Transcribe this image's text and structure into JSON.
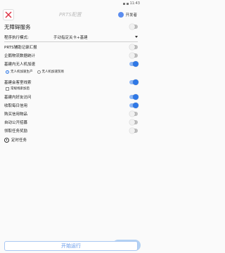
{
  "status": {
    "time": "11:43"
  },
  "header": {
    "title": "PRTS配置",
    "dev_label": "开发者"
  },
  "rows": {
    "accessibility": "无障碍服务",
    "program_mode_label": "程序执行模式:",
    "program_mode_value": "手动指定关卡+基建",
    "prts_summary": "PRTS辅助记录汇报",
    "enterprise_stats": "企鹅物流数据统计",
    "drone_accel": "基建内无人机加速",
    "radio_a": "无人机加速生产",
    "radio_b": "无人机加速贸易",
    "base_shift": "基建会客室线索",
    "shift_checkbox": "常规线索加后",
    "friend_visit": "基建内好友访问",
    "daily_credit": "收取每日信用",
    "shop": "购买信用物品",
    "auto_recruit": "自动公开招募",
    "claim_tasks": "领取任务奖励",
    "scheduled": "定时任务"
  },
  "toggles": {
    "accessibility": false,
    "prts_summary": false,
    "enterprise_stats": false,
    "drone_accel": true,
    "base_shift": true,
    "friend_visit": true,
    "daily_credit": true,
    "shop": false,
    "auto_recruit": false,
    "claim_tasks": false
  },
  "footer": {
    "start": "开始运行"
  },
  "colors": {
    "accent": "#2e78e6"
  }
}
